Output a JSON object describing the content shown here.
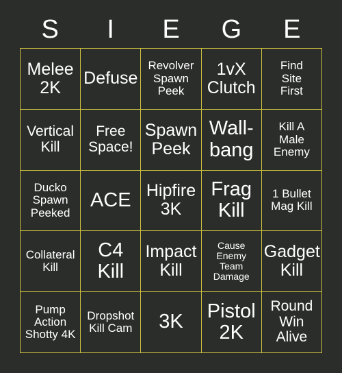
{
  "card": {
    "title": "SIEGE",
    "header_letters": [
      "S",
      "I",
      "E",
      "G",
      "E"
    ],
    "colors": {
      "background": "#2b2d2b",
      "cell_background": "#2b2d2b",
      "grid_line": "#cfc33f",
      "text": "#ffffff"
    },
    "grid_size": "5x5",
    "cells": [
      {
        "text": "Melee\n2K",
        "size": "lg"
      },
      {
        "text": "Defuse",
        "size": "lg"
      },
      {
        "text": "Revolver\nSpawn\nPeek",
        "size": "sm"
      },
      {
        "text": "1vX\nClutch",
        "size": "lg"
      },
      {
        "text": "Find\nSite\nFirst",
        "size": "sm"
      },
      {
        "text": "Vertical\nKill",
        "size": "md"
      },
      {
        "text": "Free\nSpace!",
        "size": "md"
      },
      {
        "text": "Spawn\nPeek",
        "size": "lg"
      },
      {
        "text": "Wall-\nbang",
        "size": "xl"
      },
      {
        "text": "Kill A\nMale\nEnemy",
        "size": "sm"
      },
      {
        "text": "Ducko\nSpawn\nPeeked",
        "size": "sm"
      },
      {
        "text": "ACE",
        "size": "xl"
      },
      {
        "text": "Hipfire\n3K",
        "size": "lg"
      },
      {
        "text": "Frag\nKill",
        "size": "xl"
      },
      {
        "text": "1 Bullet\nMag Kill",
        "size": "sm"
      },
      {
        "text": "Collateral\nKill",
        "size": "sm"
      },
      {
        "text": "C4\nKill",
        "size": "xl"
      },
      {
        "text": "Impact\nKill",
        "size": "lg"
      },
      {
        "text": "Cause\nEnemy\nTeam\nDamage",
        "size": "xs"
      },
      {
        "text": "Gadget\nKill",
        "size": "lg"
      },
      {
        "text": "Pump\nAction\nShotty 4K",
        "size": "sm"
      },
      {
        "text": "Dropshot\nKill Cam",
        "size": "sm"
      },
      {
        "text": "3K",
        "size": "xl"
      },
      {
        "text": "Pistol\n2K",
        "size": "xl"
      },
      {
        "text": "Round\nWin\nAlive",
        "size": "md"
      }
    ]
  }
}
